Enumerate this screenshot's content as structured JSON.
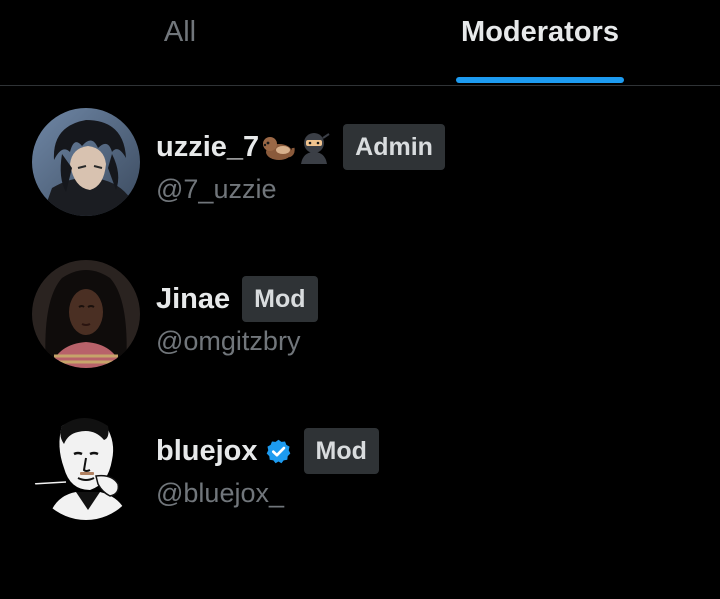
{
  "tabs": [
    {
      "label": "All",
      "active": false
    },
    {
      "label": "Moderators",
      "active": true
    }
  ],
  "colors": {
    "accent": "#1d9bf0",
    "badge_bg": "#2f3336",
    "muted_text": "#71767b",
    "primary_text": "#e7e9ea",
    "background": "#000000"
  },
  "members": [
    {
      "display_name": "uzzie_7",
      "emojis": [
        "otter-emoji",
        "ninja-emoji"
      ],
      "verified": false,
      "role": "Admin",
      "handle": "@7_uzzie",
      "avatar": "anime-character-avatar"
    },
    {
      "display_name": "Jinae",
      "emojis": [],
      "verified": false,
      "role": "Mod",
      "handle": "@omgitzbry",
      "avatar": "person-photo-avatar"
    },
    {
      "display_name": "bluejox",
      "emojis": [],
      "verified": true,
      "role": "Mod",
      "handle": "@bluejox_",
      "avatar": "sketch-portrait-avatar"
    }
  ]
}
